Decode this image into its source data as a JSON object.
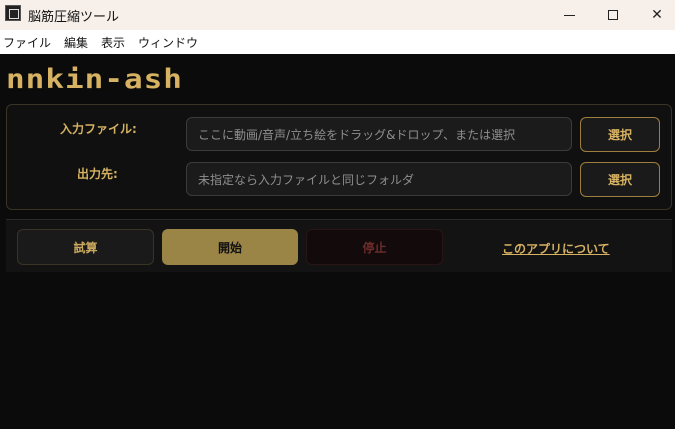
{
  "window": {
    "title": "脳筋圧縮ツール"
  },
  "menu": {
    "items": [
      "ファイル",
      "編集",
      "表示",
      "ウィンドウ"
    ]
  },
  "app": {
    "logo_text": "nnkin-ash"
  },
  "input_file": {
    "label": "入力ファイル:",
    "placeholder": "ここに動画/音声/立ち絵をドラッグ&ドロップ、または選択",
    "select_label": "選択"
  },
  "output_dir": {
    "label": "出力先:",
    "placeholder": "未指定なら入力ファイルと同じフォルダ",
    "select_label": "選択"
  },
  "actions": {
    "trial_label": "試算",
    "start_label": "開始",
    "stop_label": "停止",
    "about_label": "このアプリについて"
  },
  "colors": {
    "accent": "#d6b262",
    "start_bg": "#9a8446",
    "stop_text": "#6e2b2b",
    "background": "#0b0b0b"
  }
}
